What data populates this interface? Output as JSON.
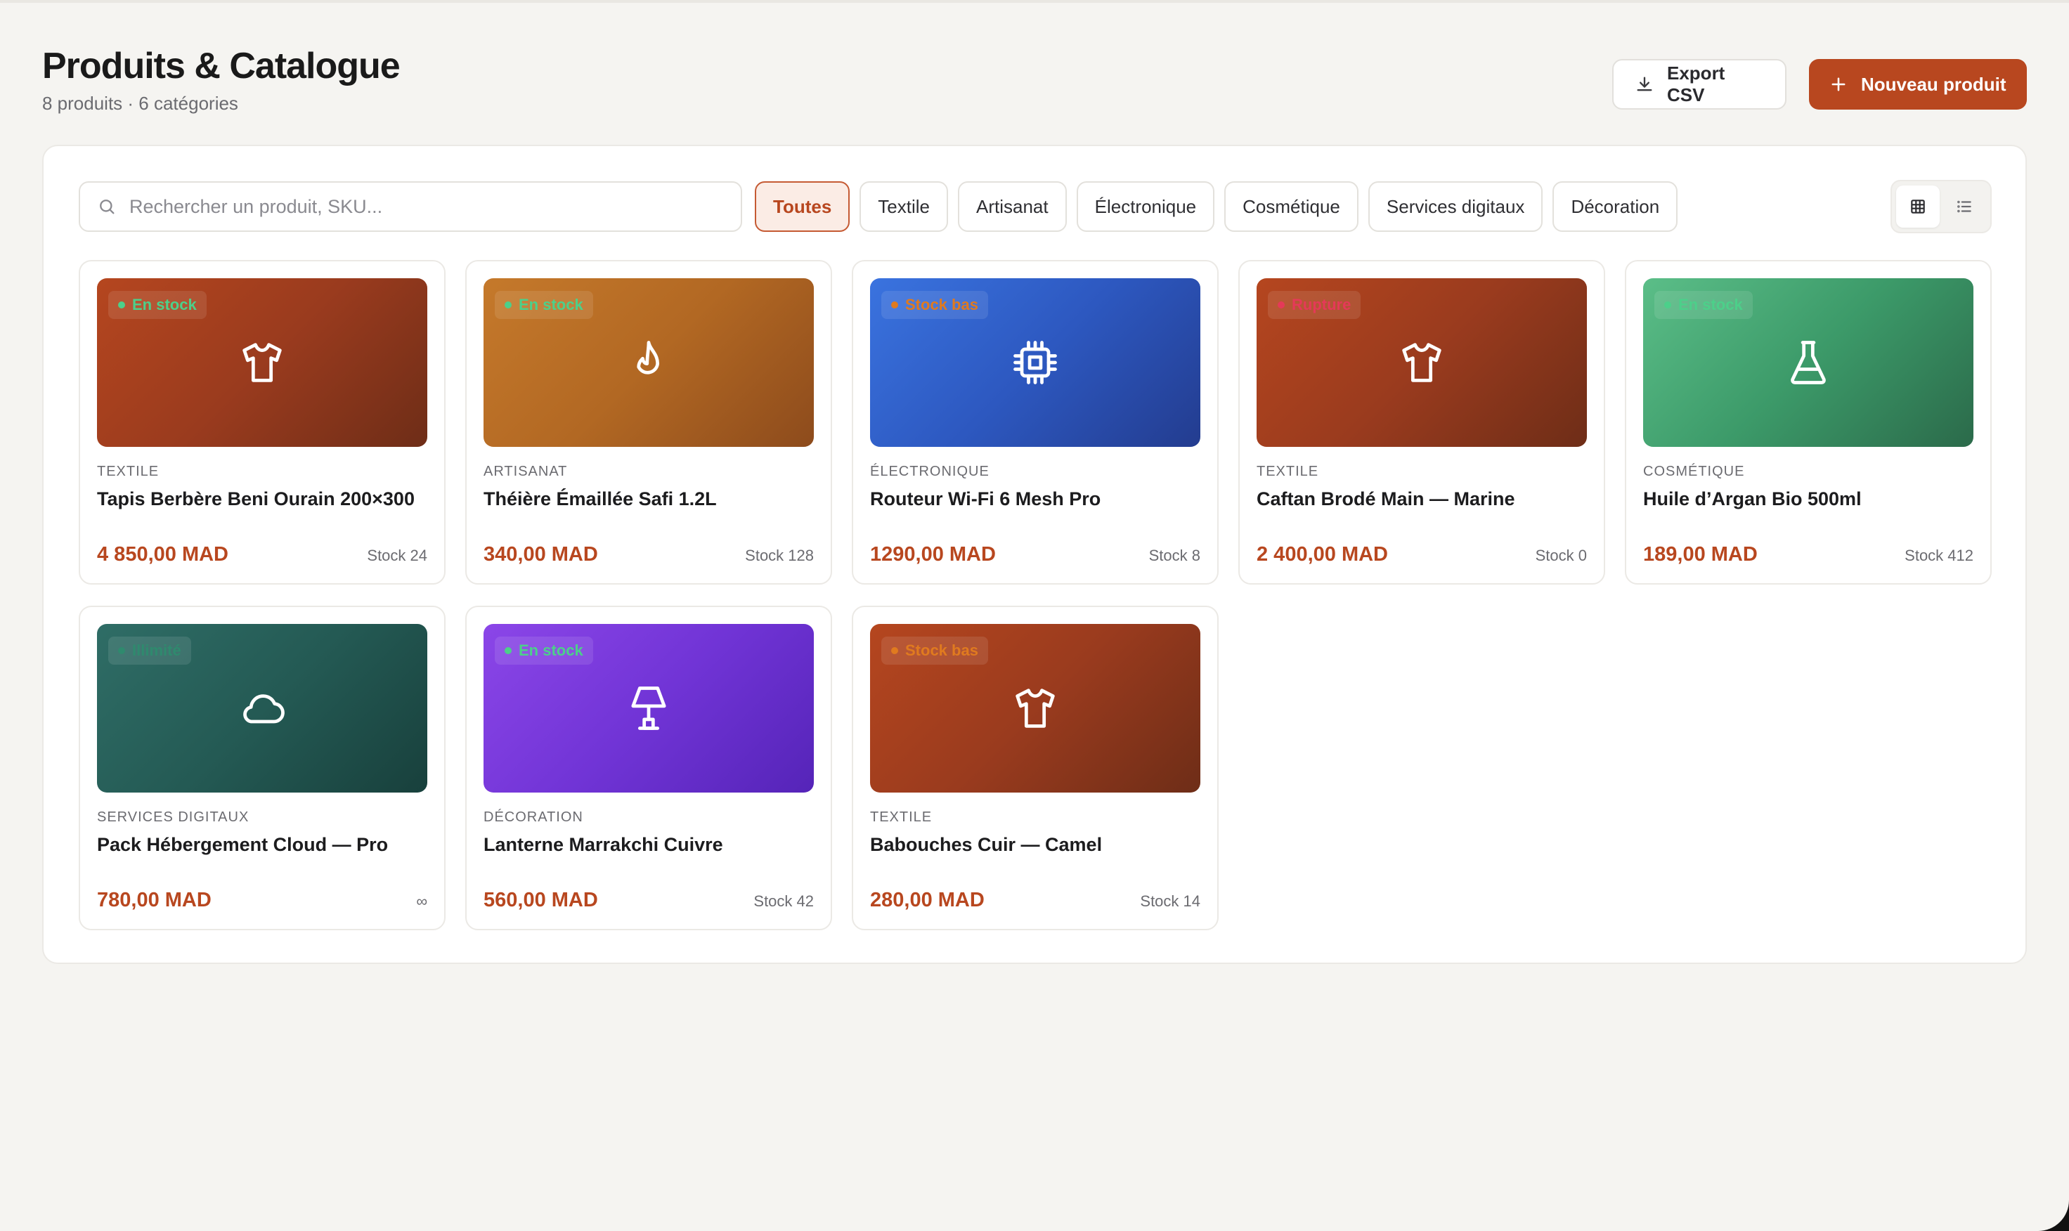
{
  "header": {
    "title": "Produits & Catalogue",
    "subtitle": "8 produits · 6 catégories",
    "export_label": "Export CSV",
    "new_label": "Nouveau produit"
  },
  "search": {
    "placeholder": "Rechercher un produit, SKU..."
  },
  "filters": [
    {
      "label": "Toutes",
      "active": true
    },
    {
      "label": "Textile",
      "active": false
    },
    {
      "label": "Artisanat",
      "active": false
    },
    {
      "label": "Électronique",
      "active": false
    },
    {
      "label": "Cosmétique",
      "active": false
    },
    {
      "label": "Services digitaux",
      "active": false
    },
    {
      "label": "Décoration",
      "active": false
    }
  ],
  "view_toggle": {
    "active": "grid"
  },
  "products": [
    {
      "category": "TEXTILE",
      "name": "Tapis Berbère Beni Ourain 200×300",
      "price": "4 850,00 MAD",
      "stock": "Stock 24",
      "status": "En stock",
      "status_color": "#4cd08a",
      "icon": "shirt-icon",
      "theme": "textile"
    },
    {
      "category": "ARTISANAT",
      "name": "Théière Émaillée Safi 1.2L",
      "price": "340,00 MAD",
      "stock": "Stock 128",
      "status": "En stock",
      "status_color": "#4cd08a",
      "icon": "flame-icon",
      "theme": "artisanat"
    },
    {
      "category": "ÉLECTRONIQUE",
      "name": "Routeur Wi-Fi 6 Mesh Pro",
      "price": "1290,00 MAD",
      "stock": "Stock 8",
      "status": "Stock bas",
      "status_color": "#e07a1f",
      "icon": "cpu-icon",
      "theme": "electro"
    },
    {
      "category": "TEXTILE",
      "name": "Caftan Brodé Main — Marine",
      "price": "2 400,00 MAD",
      "stock": "Stock 0",
      "status": "Rupture",
      "status_color": "#e53958",
      "icon": "shirt-icon",
      "theme": "textile"
    },
    {
      "category": "COSMÉTIQUE",
      "name": "Huile d’Argan Bio 500ml",
      "price": "189,00 MAD",
      "stock": "Stock 412",
      "status": "En stock",
      "status_color": "#4cd08a",
      "icon": "flask-icon",
      "theme": "cosme"
    },
    {
      "category": "SERVICES DIGITAUX",
      "name": "Pack Hébergement Cloud — Pro",
      "price": "780,00 MAD",
      "stock": "∞",
      "status": "Illimité",
      "status_color": "#2f8a6e",
      "icon": "cloud-icon",
      "theme": "services"
    },
    {
      "category": "DÉCORATION",
      "name": "Lanterne Marrakchi Cuivre",
      "price": "560,00 MAD",
      "stock": "Stock 42",
      "status": "En stock",
      "status_color": "#4cd08a",
      "icon": "lamp-icon",
      "theme": "deco"
    },
    {
      "category": "TEXTILE",
      "name": "Babouches Cuir — Camel",
      "price": "280,00 MAD",
      "stock": "Stock 14",
      "status": "Stock bas",
      "status_color": "#e07a1f",
      "icon": "shirt-icon",
      "theme": "textile"
    }
  ],
  "colors": {
    "accent": "#b8471f",
    "accent_soft": "#fbece5",
    "background": "#f5f4f1"
  }
}
